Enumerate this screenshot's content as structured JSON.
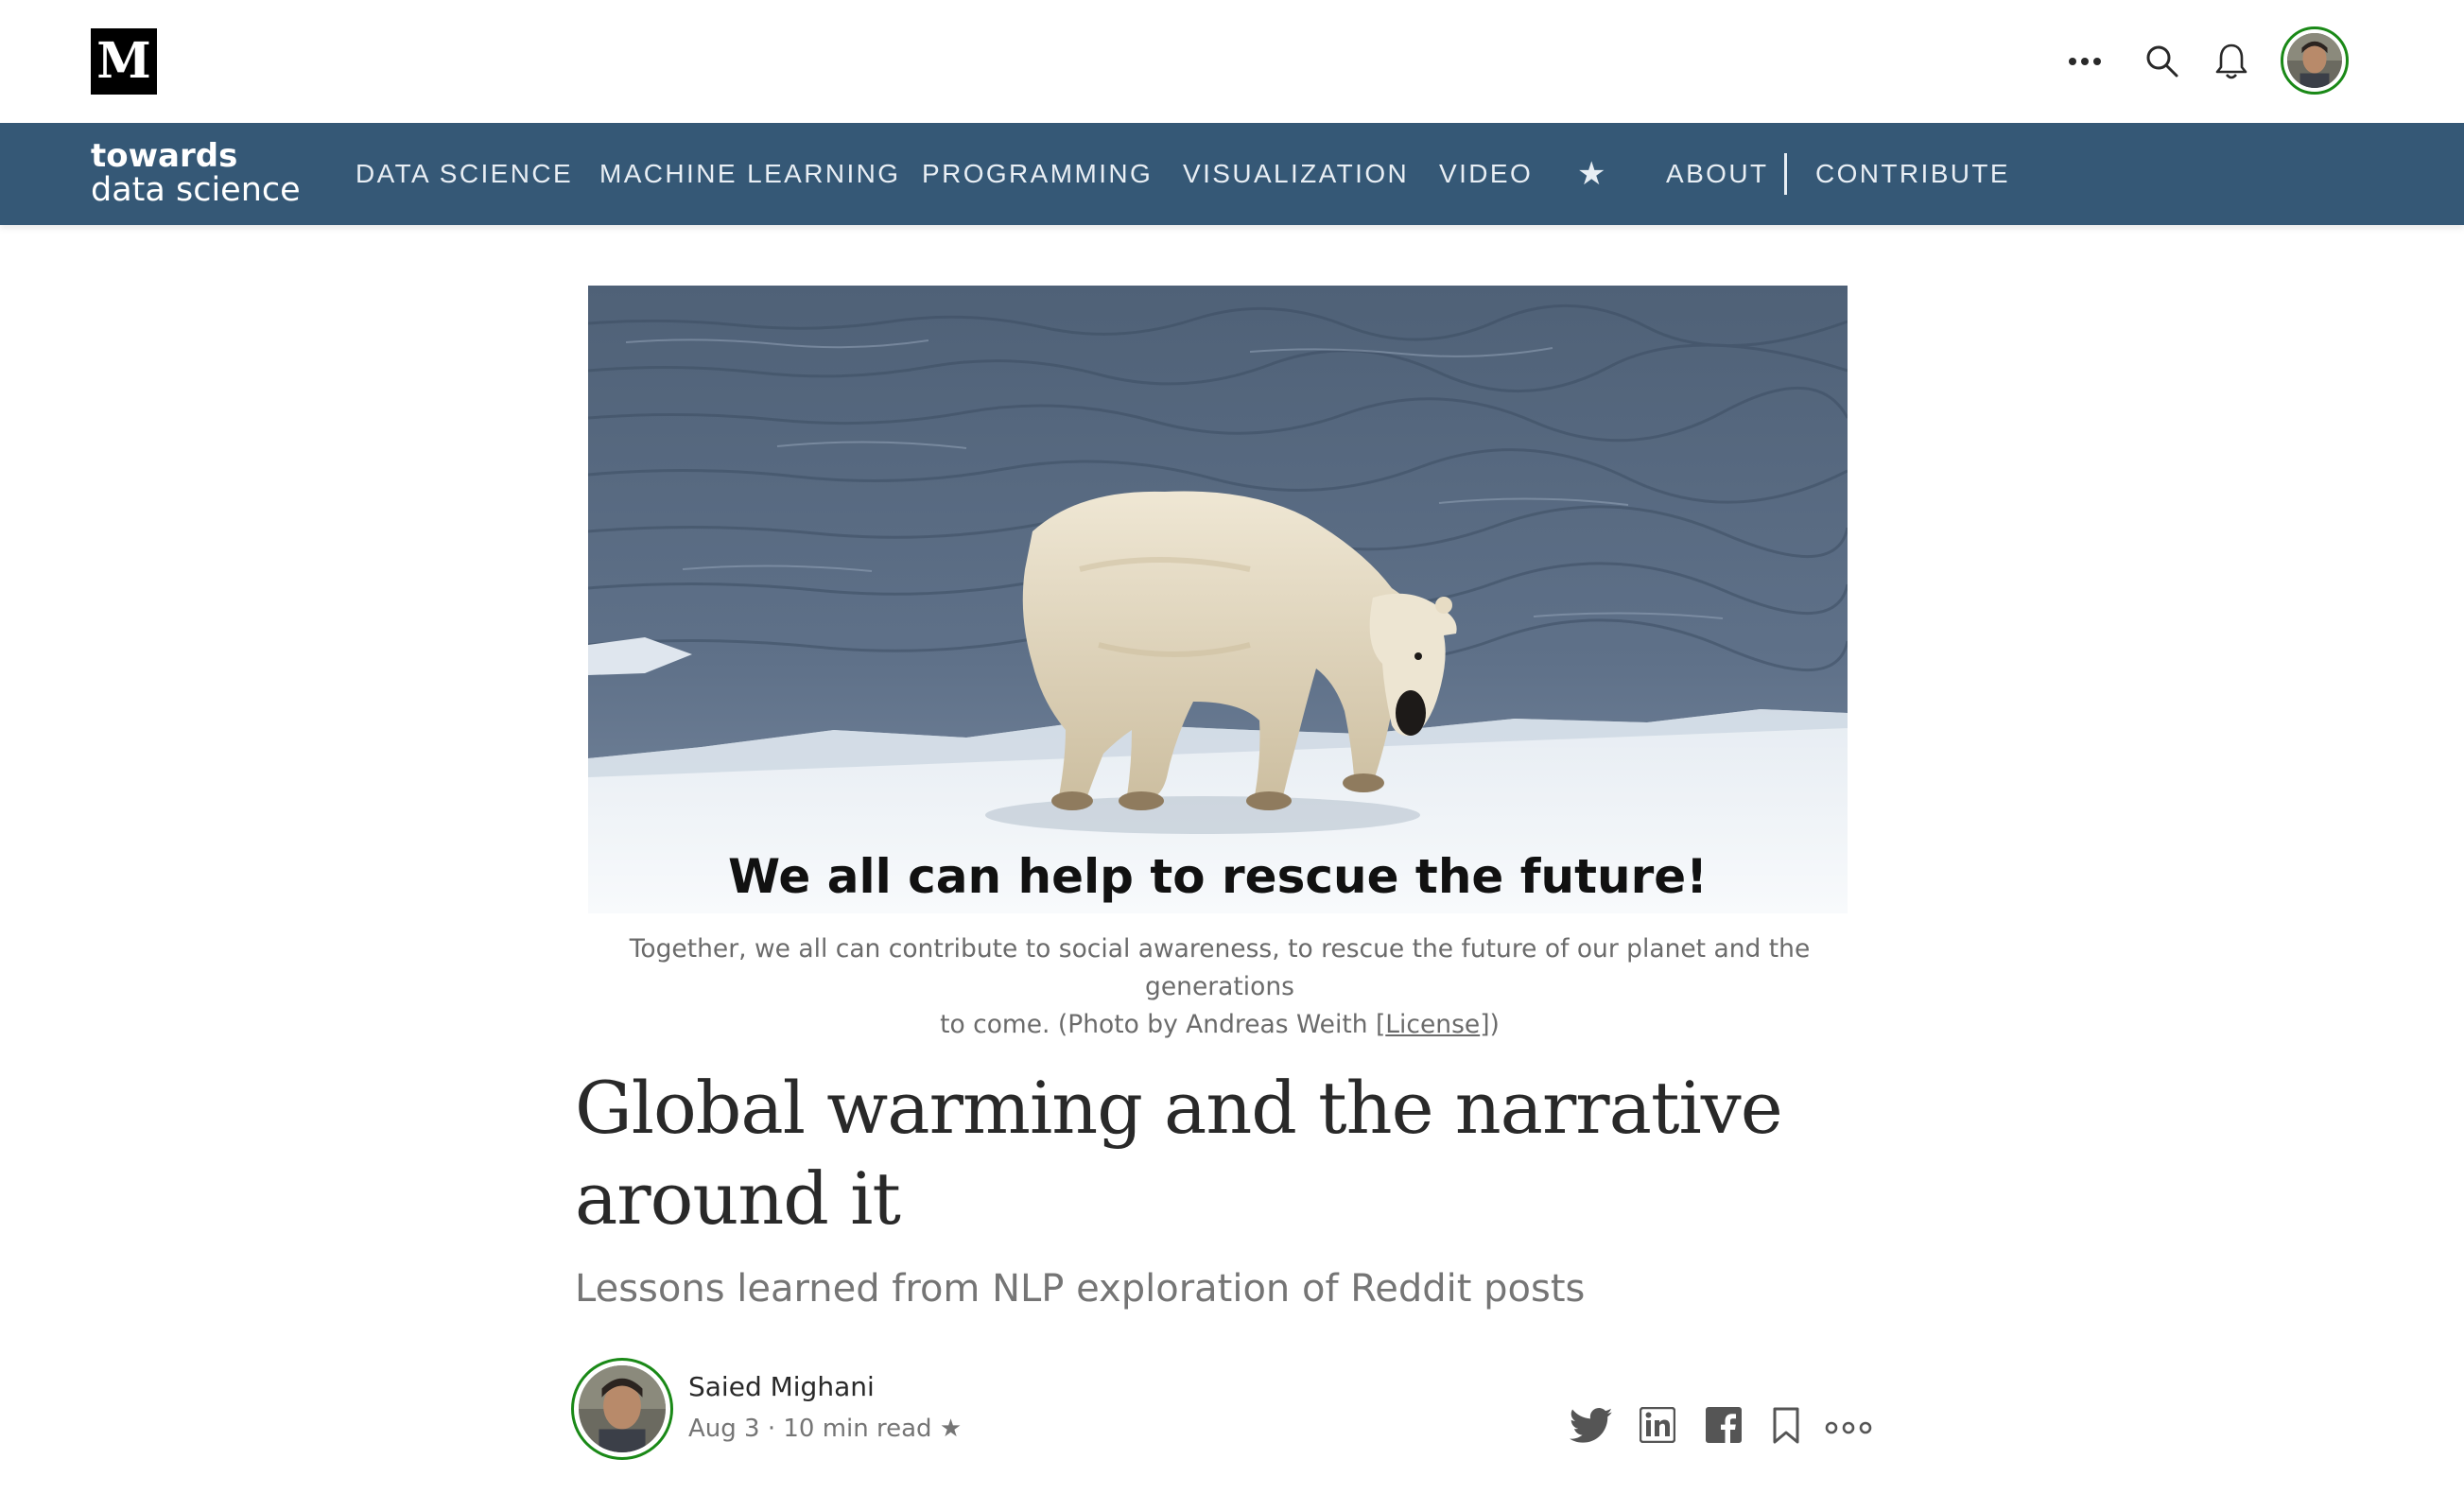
{
  "topbar": {
    "logo_letter": "M",
    "icons": [
      "more-horizontal-icon",
      "search-icon",
      "bell-icon",
      "user-avatar"
    ]
  },
  "nav": {
    "brand_line1": "towards",
    "brand_line2": "data science",
    "items": [
      {
        "label": "DATA SCIENCE"
      },
      {
        "label": "MACHINE LEARNING"
      },
      {
        "label": "PROGRAMMING"
      },
      {
        "label": "VISUALIZATION"
      },
      {
        "label": "VIDEO"
      },
      {
        "label": "★"
      },
      {
        "label": "ABOUT"
      },
      {
        "label": "CONTRIBUTE"
      }
    ]
  },
  "hero": {
    "overlay_text": "We all can help to rescue the future!",
    "caption_line1": "Together, we all can contribute to social awareness, to rescue the future of our planet and the generations",
    "caption_line2_prefix": "to come. (Photo by Andreas Weith [",
    "caption_link": "License",
    "caption_line2_suffix": "])"
  },
  "article": {
    "title_line1": "Global warming and the narrative",
    "title_line2": "around it",
    "subtitle": "Lessons learned from NLP exploration of Reddit posts",
    "author": "Saied Mighani",
    "meta": "Aug 3 · 10 min read ★"
  },
  "colors": {
    "nav_bg": "#355876",
    "title": "#292929",
    "muted": "#757575",
    "avatar_ring": "#1a8917"
  }
}
